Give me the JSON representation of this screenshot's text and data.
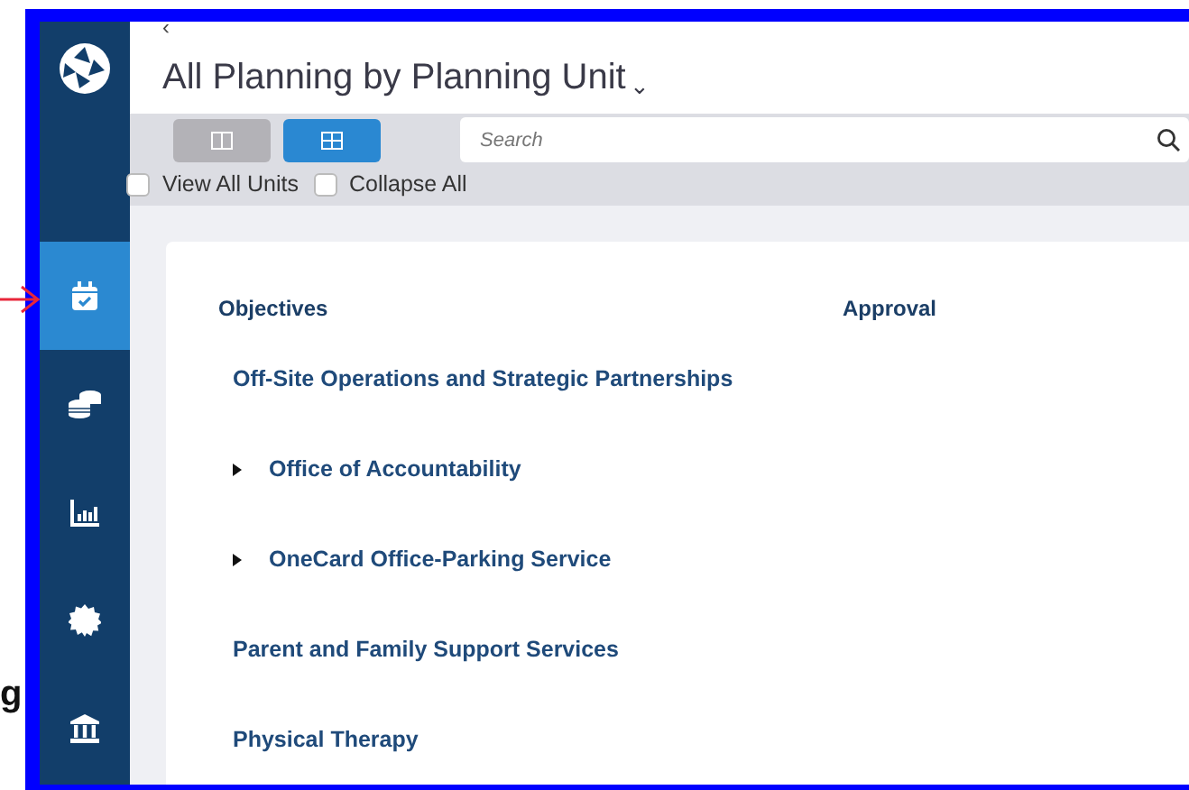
{
  "annotation": {
    "side_text": "g"
  },
  "sidebar": {
    "items": [
      {
        "selected": true
      },
      {
        "selected": false
      },
      {
        "selected": false
      },
      {
        "selected": false
      },
      {
        "selected": false
      }
    ]
  },
  "header": {
    "back": "‹",
    "title": "All Planning by Planning Unit",
    "caret": "⌄"
  },
  "toolbar": {
    "views": [
      {
        "selected": false
      },
      {
        "selected": true
      }
    ],
    "search": {
      "placeholder": "Search"
    },
    "checkboxes": [
      {
        "label": "View All Units",
        "checked": false
      },
      {
        "label": "Collapse All",
        "checked": false
      }
    ]
  },
  "table": {
    "columns": [
      "Objectives",
      "Approval"
    ],
    "rows": [
      {
        "label": "Off-Site Operations and Strategic Partnerships",
        "kind": "plain"
      },
      {
        "label": "Office of Accountability",
        "kind": "expandable"
      },
      {
        "label": "OneCard Office-Parking Service",
        "kind": "expandable"
      },
      {
        "label": "Parent and Family Support Services",
        "kind": "plain"
      },
      {
        "label": "Physical Therapy",
        "kind": "plain"
      }
    ]
  }
}
